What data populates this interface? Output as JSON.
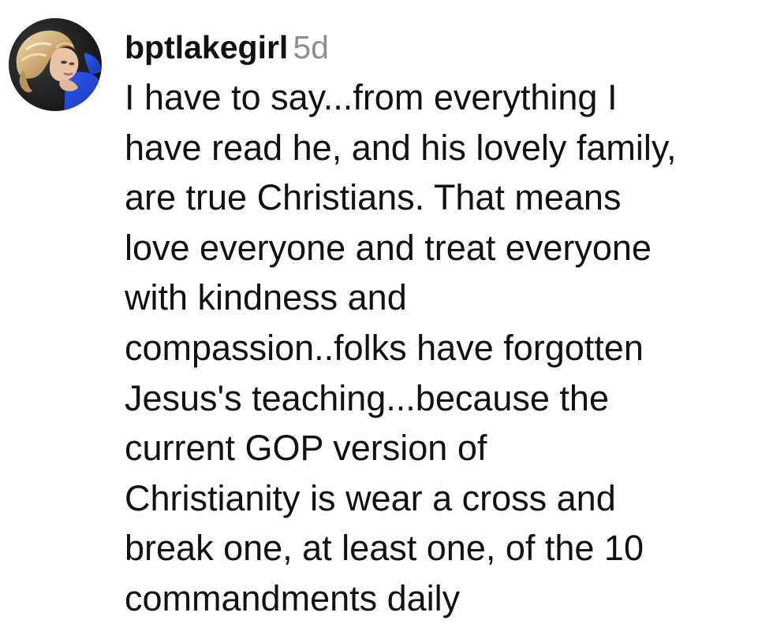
{
  "comment": {
    "username": "bptlakegirl",
    "timestamp": "5d",
    "avatar_icon": "user-avatar-photo",
    "text_lines": [
      "I have to say...from everything I",
      "have read he, and his lovely family,",
      "are true Christians. That means",
      "love everyone and treat everyone",
      "with kindness and",
      "compassion..folks have forgotten",
      "Jesus's teaching...because the",
      "current GOP version of",
      "Christianity is wear a cross and",
      "break one, at least one, of the 10",
      "commandments daily"
    ]
  },
  "colors": {
    "text": "#111111",
    "timestamp": "#8e8e8e",
    "background": "#ffffff",
    "avatar_dark": "#1c1c1e",
    "avatar_blue": "#1f46d1",
    "avatar_hair": "#d8b98a"
  }
}
